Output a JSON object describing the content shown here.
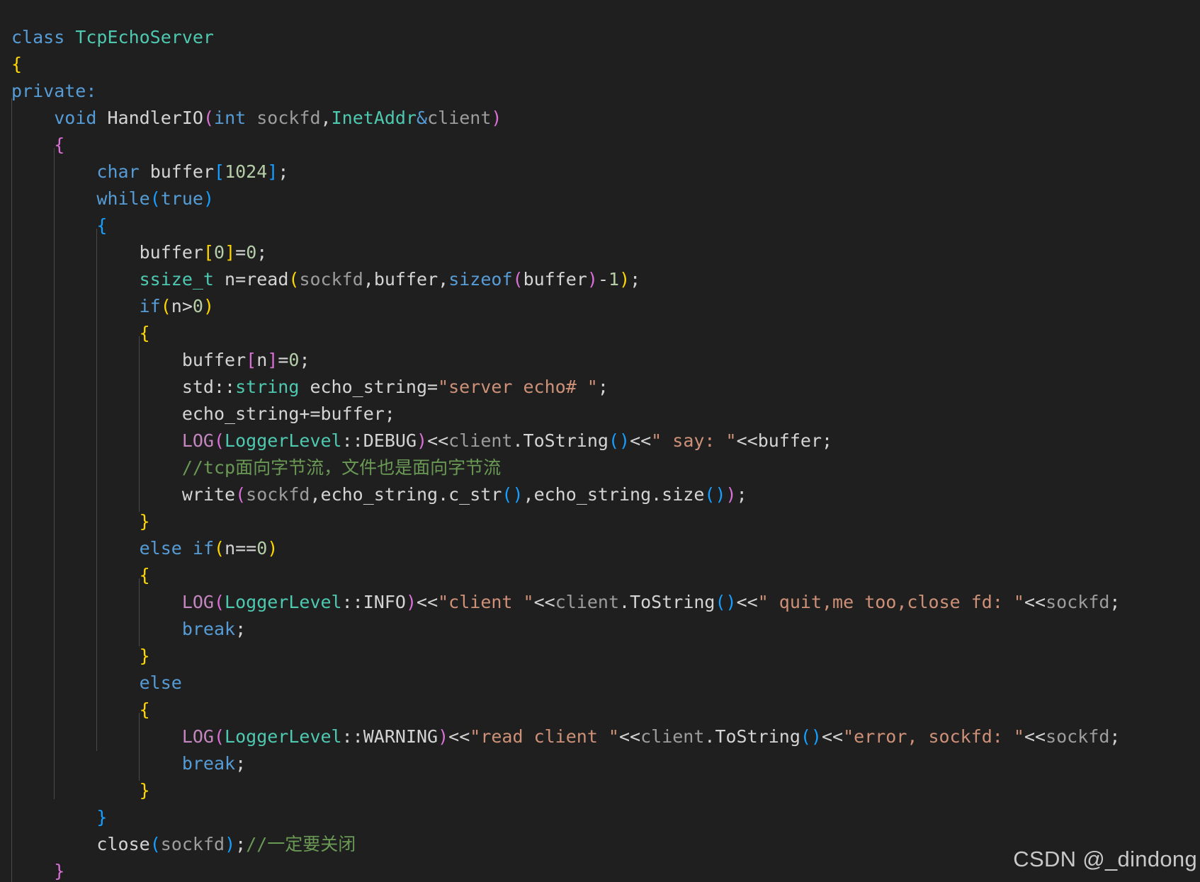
{
  "colors": {
    "background": "#1f1f1f",
    "keyword": "#569cd6",
    "control": "#c586c0",
    "type": "#4ec9b0",
    "function": "#dcdcaa",
    "variable": "#9cdcfe",
    "parameter": "#9d9d9d",
    "text": "#d4d4d4",
    "number": "#b5cea8",
    "string": "#ce9178",
    "comment": "#6a9955",
    "macro": "#c586c0",
    "bracket_gold": "#ffd700",
    "bracket_pink": "#da70d6",
    "bracket_blue": "#179fff"
  },
  "code_lines": [
    [
      {
        "t": "class ",
        "c": "keyword"
      },
      {
        "t": "TcpEchoServer",
        "c": "type"
      }
    ],
    [
      {
        "t": "{",
        "c": "bracket_gold"
      }
    ],
    [
      {
        "t": "private:",
        "c": "keyword"
      }
    ],
    [
      {
        "t": "    "
      },
      {
        "t": "void ",
        "c": "keyword"
      },
      {
        "t": "HandlerIO",
        "c": "text"
      },
      {
        "t": "(",
        "c": "bracket_pink"
      },
      {
        "t": "int ",
        "c": "keyword"
      },
      {
        "t": "sockfd",
        "c": "parameter"
      },
      {
        "t": ",",
        "c": "text"
      },
      {
        "t": "InetAddr",
        "c": "type"
      },
      {
        "t": "&",
        "c": "keyword"
      },
      {
        "t": "client",
        "c": "parameter"
      },
      {
        "t": ")",
        "c": "bracket_pink"
      }
    ],
    [
      {
        "t": "    "
      },
      {
        "t": "{",
        "c": "bracket_pink"
      }
    ],
    [
      {
        "t": "        "
      },
      {
        "t": "char ",
        "c": "keyword"
      },
      {
        "t": "buffer",
        "c": "text"
      },
      {
        "t": "[",
        "c": "bracket_blue"
      },
      {
        "t": "1024",
        "c": "number"
      },
      {
        "t": "]",
        "c": "bracket_blue"
      },
      {
        "t": ";",
        "c": "text"
      }
    ],
    [
      {
        "t": "        "
      },
      {
        "t": "while",
        "c": "keyword"
      },
      {
        "t": "(",
        "c": "bracket_blue"
      },
      {
        "t": "true",
        "c": "keyword"
      },
      {
        "t": ")",
        "c": "bracket_blue"
      }
    ],
    [
      {
        "t": "        "
      },
      {
        "t": "{",
        "c": "bracket_blue"
      }
    ],
    [
      {
        "t": "            "
      },
      {
        "t": "buffer",
        "c": "text"
      },
      {
        "t": "[",
        "c": "bracket_gold"
      },
      {
        "t": "0",
        "c": "number"
      },
      {
        "t": "]",
        "c": "bracket_gold"
      },
      {
        "t": "=",
        "c": "text"
      },
      {
        "t": "0",
        "c": "number"
      },
      {
        "t": ";",
        "c": "text"
      }
    ],
    [
      {
        "t": "            "
      },
      {
        "t": "ssize_t ",
        "c": "type"
      },
      {
        "t": "n",
        "c": "text"
      },
      {
        "t": "=",
        "c": "text"
      },
      {
        "t": "read",
        "c": "text"
      },
      {
        "t": "(",
        "c": "bracket_gold"
      },
      {
        "t": "sockfd",
        "c": "parameter"
      },
      {
        "t": ",buffer,",
        "c": "text"
      },
      {
        "t": "sizeof",
        "c": "keyword"
      },
      {
        "t": "(",
        "c": "bracket_pink"
      },
      {
        "t": "buffer",
        "c": "text"
      },
      {
        "t": ")",
        "c": "bracket_pink"
      },
      {
        "t": "-",
        "c": "text"
      },
      {
        "t": "1",
        "c": "number"
      },
      {
        "t": ")",
        "c": "bracket_gold"
      },
      {
        "t": ";",
        "c": "text"
      }
    ],
    [
      {
        "t": "            "
      },
      {
        "t": "if",
        "c": "keyword"
      },
      {
        "t": "(",
        "c": "bracket_gold"
      },
      {
        "t": "n>",
        "c": "text"
      },
      {
        "t": "0",
        "c": "number"
      },
      {
        "t": ")",
        "c": "bracket_gold"
      }
    ],
    [
      {
        "t": "            "
      },
      {
        "t": "{",
        "c": "bracket_gold"
      }
    ],
    [
      {
        "t": "                "
      },
      {
        "t": "buffer",
        "c": "text"
      },
      {
        "t": "[",
        "c": "bracket_pink"
      },
      {
        "t": "n",
        "c": "text"
      },
      {
        "t": "]",
        "c": "bracket_pink"
      },
      {
        "t": "=",
        "c": "text"
      },
      {
        "t": "0",
        "c": "number"
      },
      {
        "t": ";",
        "c": "text"
      }
    ],
    [
      {
        "t": "                "
      },
      {
        "t": "std",
        "c": "text"
      },
      {
        "t": "::",
        "c": "text"
      },
      {
        "t": "string ",
        "c": "type"
      },
      {
        "t": "echo_string=",
        "c": "text"
      },
      {
        "t": "\"server echo# \"",
        "c": "string"
      },
      {
        "t": ";",
        "c": "text"
      }
    ],
    [
      {
        "t": "                "
      },
      {
        "t": "echo_string+=buffer;",
        "c": "text"
      }
    ],
    [
      {
        "t": "                "
      },
      {
        "t": "LOG",
        "c": "macro"
      },
      {
        "t": "(",
        "c": "bracket_pink"
      },
      {
        "t": "LoggerLevel",
        "c": "type"
      },
      {
        "t": "::",
        "c": "text"
      },
      {
        "t": "DEBUG",
        "c": "text"
      },
      {
        "t": ")",
        "c": "bracket_pink"
      },
      {
        "t": "<<",
        "c": "text"
      },
      {
        "t": "client",
        "c": "parameter"
      },
      {
        "t": ".ToString",
        "c": "text"
      },
      {
        "t": "()",
        "c": "bracket_blue"
      },
      {
        "t": "<<",
        "c": "text"
      },
      {
        "t": "\" say: \"",
        "c": "string"
      },
      {
        "t": "<<buffer;",
        "c": "text"
      }
    ],
    [
      {
        "t": "                "
      },
      {
        "t": "//tcp面向字节流，文件也是面向字节流",
        "c": "comment"
      }
    ],
    [
      {
        "t": "                "
      },
      {
        "t": "write",
        "c": "text"
      },
      {
        "t": "(",
        "c": "bracket_pink"
      },
      {
        "t": "sockfd",
        "c": "parameter"
      },
      {
        "t": ",echo_string.c_str",
        "c": "text"
      },
      {
        "t": "()",
        "c": "bracket_blue"
      },
      {
        "t": ",echo_string.size",
        "c": "text"
      },
      {
        "t": "()",
        "c": "bracket_blue"
      },
      {
        "t": ")",
        "c": "bracket_pink"
      },
      {
        "t": ";",
        "c": "text"
      }
    ],
    [
      {
        "t": "            "
      },
      {
        "t": "}",
        "c": "bracket_gold"
      }
    ],
    [
      {
        "t": "            "
      },
      {
        "t": "else ",
        "c": "keyword"
      },
      {
        "t": "if",
        "c": "keyword"
      },
      {
        "t": "(",
        "c": "bracket_gold"
      },
      {
        "t": "n==",
        "c": "text"
      },
      {
        "t": "0",
        "c": "number"
      },
      {
        "t": ")",
        "c": "bracket_gold"
      }
    ],
    [
      {
        "t": "            "
      },
      {
        "t": "{",
        "c": "bracket_gold"
      }
    ],
    [
      {
        "t": "                "
      },
      {
        "t": "LOG",
        "c": "macro"
      },
      {
        "t": "(",
        "c": "bracket_pink"
      },
      {
        "t": "LoggerLevel",
        "c": "type"
      },
      {
        "t": "::",
        "c": "text"
      },
      {
        "t": "INFO",
        "c": "text"
      },
      {
        "t": ")",
        "c": "bracket_pink"
      },
      {
        "t": "<<",
        "c": "text"
      },
      {
        "t": "\"client \"",
        "c": "string"
      },
      {
        "t": "<<",
        "c": "text"
      },
      {
        "t": "client",
        "c": "parameter"
      },
      {
        "t": ".ToString",
        "c": "text"
      },
      {
        "t": "()",
        "c": "bracket_blue"
      },
      {
        "t": "<<",
        "c": "text"
      },
      {
        "t": "\" quit,me too,close fd: \"",
        "c": "string"
      },
      {
        "t": "<<",
        "c": "text"
      },
      {
        "t": "sockfd",
        "c": "parameter"
      },
      {
        "t": ";",
        "c": "text"
      }
    ],
    [
      {
        "t": "                "
      },
      {
        "t": "break",
        "c": "keyword"
      },
      {
        "t": ";",
        "c": "text"
      }
    ],
    [
      {
        "t": "            "
      },
      {
        "t": "}",
        "c": "bracket_gold"
      }
    ],
    [
      {
        "t": "            "
      },
      {
        "t": "else",
        "c": "keyword"
      }
    ],
    [
      {
        "t": "            "
      },
      {
        "t": "{",
        "c": "bracket_gold"
      }
    ],
    [
      {
        "t": "                "
      },
      {
        "t": "LOG",
        "c": "macro"
      },
      {
        "t": "(",
        "c": "bracket_pink"
      },
      {
        "t": "LoggerLevel",
        "c": "type"
      },
      {
        "t": "::",
        "c": "text"
      },
      {
        "t": "WARNING",
        "c": "text"
      },
      {
        "t": ")",
        "c": "bracket_pink"
      },
      {
        "t": "<<",
        "c": "text"
      },
      {
        "t": "\"read client \"",
        "c": "string"
      },
      {
        "t": "<<",
        "c": "text"
      },
      {
        "t": "client",
        "c": "parameter"
      },
      {
        "t": ".ToString",
        "c": "text"
      },
      {
        "t": "()",
        "c": "bracket_blue"
      },
      {
        "t": "<<",
        "c": "text"
      },
      {
        "t": "\"error, sockfd: \"",
        "c": "string"
      },
      {
        "t": "<<",
        "c": "text"
      },
      {
        "t": "sockfd",
        "c": "parameter"
      },
      {
        "t": ";",
        "c": "text"
      }
    ],
    [
      {
        "t": "                "
      },
      {
        "t": "break",
        "c": "keyword"
      },
      {
        "t": ";",
        "c": "text"
      }
    ],
    [
      {
        "t": "            "
      },
      {
        "t": "}",
        "c": "bracket_gold"
      }
    ],
    [
      {
        "t": "        "
      },
      {
        "t": "}",
        "c": "bracket_blue"
      }
    ],
    [
      {
        "t": "        "
      },
      {
        "t": "close",
        "c": "text"
      },
      {
        "t": "(",
        "c": "bracket_blue"
      },
      {
        "t": "sockfd",
        "c": "parameter"
      },
      {
        "t": ")",
        "c": "bracket_blue"
      },
      {
        "t": ";",
        "c": "text"
      },
      {
        "t": "//一定要关闭",
        "c": "comment"
      }
    ],
    [
      {
        "t": "    "
      },
      {
        "t": "}",
        "c": "bracket_pink"
      }
    ]
  ],
  "watermark": "CSDN @_dindong"
}
